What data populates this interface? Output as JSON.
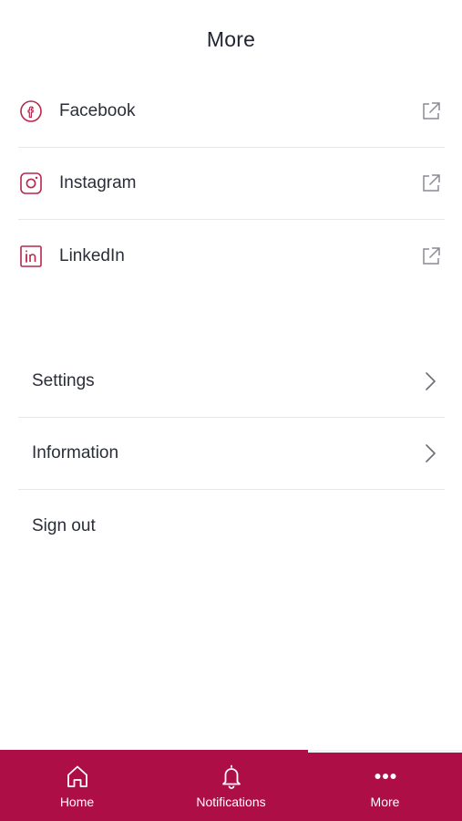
{
  "header": {
    "title": "More"
  },
  "social": [
    {
      "label": "Facebook",
      "icon": "facebook-icon"
    },
    {
      "label": "Instagram",
      "icon": "instagram-icon"
    },
    {
      "label": "LinkedIn",
      "icon": "linkedin-icon"
    }
  ],
  "menu": [
    {
      "label": "Settings",
      "icon": "chevron-right-icon"
    },
    {
      "label": "Information",
      "icon": "chevron-right-icon"
    },
    {
      "label": "Sign out"
    }
  ],
  "tabs": [
    {
      "label": "Home",
      "icon": "home-icon"
    },
    {
      "label": "Notifications",
      "icon": "bell-icon"
    },
    {
      "label": "More",
      "icon": "more-dots-icon"
    }
  ],
  "colors": {
    "brand": "#ad0e46",
    "icon_accent": "#b5284f",
    "divider": "#e8e8ea",
    "text": "#2a2e38"
  }
}
